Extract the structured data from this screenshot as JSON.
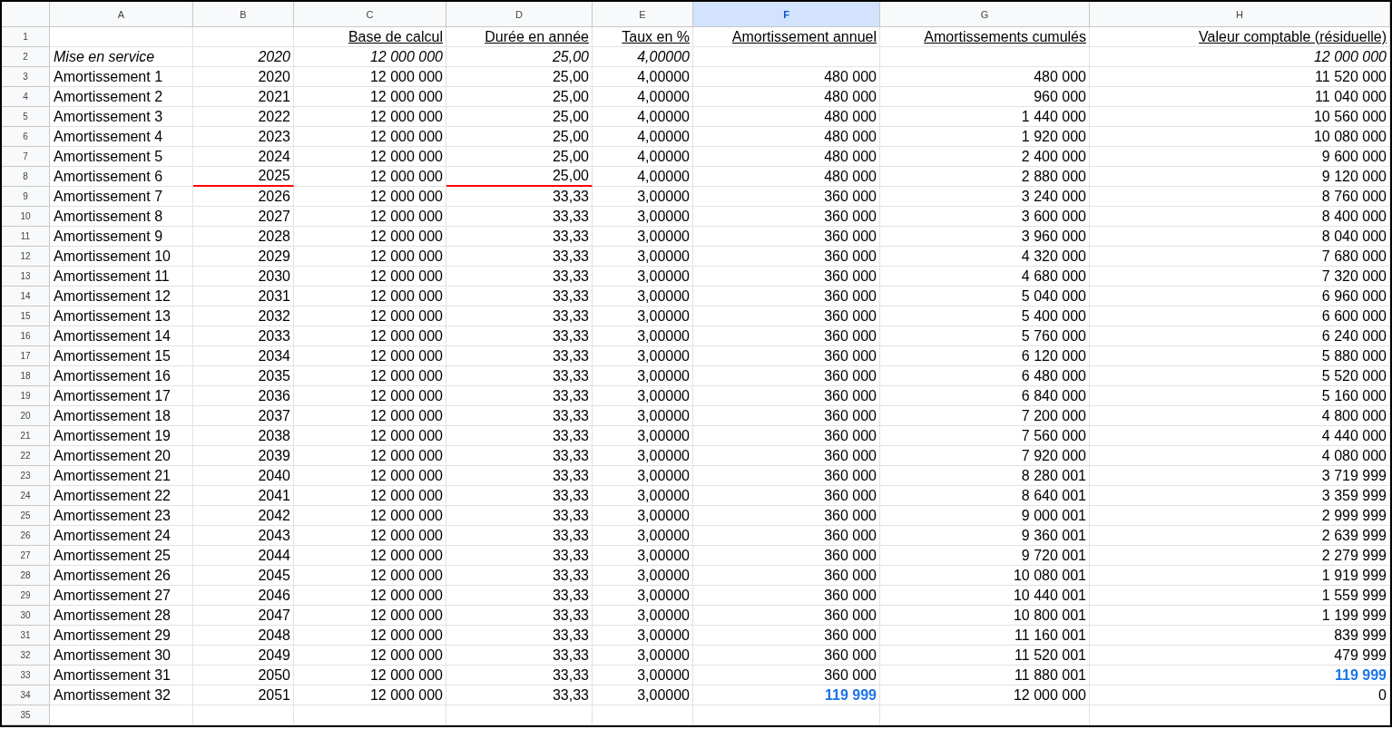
{
  "columns": [
    {
      "label": "A",
      "selected": false
    },
    {
      "label": "B",
      "selected": false
    },
    {
      "label": "C",
      "selected": false
    },
    {
      "label": "D",
      "selected": false
    },
    {
      "label": "E",
      "selected": false
    },
    {
      "label": "F",
      "selected": true
    },
    {
      "label": "G",
      "selected": false
    },
    {
      "label": "H",
      "selected": false
    }
  ],
  "rows": [
    {
      "number": "1",
      "kind": "header",
      "cells": [
        null,
        null,
        "Base de calcul",
        "Durée en année",
        "Taux en %",
        "Amortissement annuel",
        "Amortissements cumulés",
        "Valeur comptable (résiduelle)"
      ]
    },
    {
      "number": "2",
      "kind": "italic",
      "cells": [
        "Mise en service",
        "2020",
        "12 000 000",
        "25,00",
        "4,00000",
        null,
        null,
        "12 000 000"
      ]
    },
    {
      "number": "3",
      "kind": "data",
      "cells": [
        "Amortissement 1",
        "2020",
        "12 000 000",
        "25,00",
        "4,00000",
        "480 000",
        "480 000",
        "11 520 000"
      ]
    },
    {
      "number": "4",
      "kind": "data",
      "cells": [
        "Amortissement 2",
        "2021",
        "12 000 000",
        "25,00",
        "4,00000",
        "480 000",
        "960 000",
        "11 040 000"
      ]
    },
    {
      "number": "5",
      "kind": "data",
      "cells": [
        "Amortissement 3",
        "2022",
        "12 000 000",
        "25,00",
        "4,00000",
        "480 000",
        "1 440 000",
        "10 560 000"
      ]
    },
    {
      "number": "6",
      "kind": "data",
      "cells": [
        "Amortissement 4",
        "2023",
        "12 000 000",
        "25,00",
        "4,00000",
        "480 000",
        "1 920 000",
        "10 080 000"
      ]
    },
    {
      "number": "7",
      "kind": "data",
      "cells": [
        "Amortissement 5",
        "2024",
        "12 000 000",
        "25,00",
        "4,00000",
        "480 000",
        "2 400 000",
        "9 600 000"
      ]
    },
    {
      "number": "8",
      "kind": "data",
      "cells": [
        "Amortissement 6",
        {
          "text": "2025",
          "kind": "red-underline"
        },
        "12 000 000",
        {
          "text": "25,00",
          "kind": "red-underline"
        },
        "4,00000",
        "480 000",
        "2 880 000",
        "9 120 000"
      ]
    },
    {
      "number": "9",
      "kind": "data",
      "cells": [
        "Amortissement 7",
        "2026",
        "12 000 000",
        "33,33",
        "3,00000",
        "360 000",
        "3 240 000",
        "8 760 000"
      ]
    },
    {
      "number": "10",
      "kind": "data",
      "cells": [
        "Amortissement 8",
        "2027",
        "12 000 000",
        "33,33",
        "3,00000",
        "360 000",
        "3 600 000",
        "8 400 000"
      ]
    },
    {
      "number": "11",
      "kind": "data",
      "cells": [
        "Amortissement 9",
        "2028",
        "12 000 000",
        "33,33",
        "3,00000",
        "360 000",
        "3 960 000",
        "8 040 000"
      ]
    },
    {
      "number": "12",
      "kind": "data",
      "cells": [
        "Amortissement 10",
        "2029",
        "12 000 000",
        "33,33",
        "3,00000",
        "360 000",
        "4 320 000",
        "7 680 000"
      ]
    },
    {
      "number": "13",
      "kind": "data",
      "cells": [
        "Amortissement 11",
        "2030",
        "12 000 000",
        "33,33",
        "3,00000",
        "360 000",
        "4 680 000",
        "7 320 000"
      ]
    },
    {
      "number": "14",
      "kind": "data",
      "cells": [
        "Amortissement 12",
        "2031",
        "12 000 000",
        "33,33",
        "3,00000",
        "360 000",
        "5 040 000",
        "6 960 000"
      ]
    },
    {
      "number": "15",
      "kind": "data",
      "cells": [
        "Amortissement 13",
        "2032",
        "12 000 000",
        "33,33",
        "3,00000",
        "360 000",
        "5 400 000",
        "6 600 000"
      ]
    },
    {
      "number": "16",
      "kind": "data",
      "cells": [
        "Amortissement 14",
        "2033",
        "12 000 000",
        "33,33",
        "3,00000",
        "360 000",
        "5 760 000",
        "6 240 000"
      ]
    },
    {
      "number": "17",
      "kind": "data",
      "cells": [
        "Amortissement 15",
        "2034",
        "12 000 000",
        "33,33",
        "3,00000",
        "360 000",
        "6 120 000",
        "5 880 000"
      ]
    },
    {
      "number": "18",
      "kind": "data",
      "cells": [
        "Amortissement 16",
        "2035",
        "12 000 000",
        "33,33",
        "3,00000",
        "360 000",
        "6 480 000",
        "5 520 000"
      ]
    },
    {
      "number": "19",
      "kind": "data",
      "cells": [
        "Amortissement 17",
        "2036",
        "12 000 000",
        "33,33",
        "3,00000",
        "360 000",
        "6 840 000",
        "5 160 000"
      ]
    },
    {
      "number": "20",
      "kind": "data",
      "cells": [
        "Amortissement 18",
        "2037",
        "12 000 000",
        "33,33",
        "3,00000",
        "360 000",
        "7 200 000",
        "4 800 000"
      ]
    },
    {
      "number": "21",
      "kind": "data",
      "cells": [
        "Amortissement 19",
        "2038",
        "12 000 000",
        "33,33",
        "3,00000",
        "360 000",
        "7 560 000",
        "4 440 000"
      ]
    },
    {
      "number": "22",
      "kind": "data",
      "cells": [
        "Amortissement 20",
        "2039",
        "12 000 000",
        "33,33",
        "3,00000",
        "360 000",
        "7 920 000",
        "4 080 000"
      ]
    },
    {
      "number": "23",
      "kind": "data",
      "cells": [
        "Amortissement 21",
        "2040",
        "12 000 000",
        "33,33",
        "3,00000",
        "360 000",
        "8 280 001",
        "3 719 999"
      ]
    },
    {
      "number": "24",
      "kind": "data",
      "cells": [
        "Amortissement 22",
        "2041",
        "12 000 000",
        "33,33",
        "3,00000",
        "360 000",
        "8 640 001",
        "3 359 999"
      ]
    },
    {
      "number": "25",
      "kind": "data",
      "cells": [
        "Amortissement 23",
        "2042",
        "12 000 000",
        "33,33",
        "3,00000",
        "360 000",
        "9 000 001",
        "2 999 999"
      ]
    },
    {
      "number": "26",
      "kind": "data",
      "cells": [
        "Amortissement 24",
        "2043",
        "12 000 000",
        "33,33",
        "3,00000",
        "360 000",
        "9 360 001",
        "2 639 999"
      ]
    },
    {
      "number": "27",
      "kind": "data",
      "cells": [
        "Amortissement 25",
        "2044",
        "12 000 000",
        "33,33",
        "3,00000",
        "360 000",
        "9 720 001",
        "2 279 999"
      ]
    },
    {
      "number": "28",
      "kind": "data",
      "cells": [
        "Amortissement 26",
        "2045",
        "12 000 000",
        "33,33",
        "3,00000",
        "360 000",
        "10 080 001",
        "1 919 999"
      ]
    },
    {
      "number": "29",
      "kind": "data",
      "cells": [
        "Amortissement 27",
        "2046",
        "12 000 000",
        "33,33",
        "3,00000",
        "360 000",
        "10 440 001",
        "1 559 999"
      ]
    },
    {
      "number": "30",
      "kind": "data",
      "cells": [
        "Amortissement 28",
        "2047",
        "12 000 000",
        "33,33",
        "3,00000",
        "360 000",
        "10 800 001",
        "1 199 999"
      ]
    },
    {
      "number": "31",
      "kind": "data",
      "cells": [
        "Amortissement 29",
        "2048",
        "12 000 000",
        "33,33",
        "3,00000",
        "360 000",
        "11 160 001",
        "839 999"
      ]
    },
    {
      "number": "32",
      "kind": "data",
      "cells": [
        "Amortissement 30",
        "2049",
        "12 000 000",
        "33,33",
        "3,00000",
        "360 000",
        "11 520 001",
        "479 999"
      ]
    },
    {
      "number": "33",
      "kind": "data",
      "cells": [
        "Amortissement 31",
        "2050",
        "12 000 000",
        "33,33",
        "3,00000",
        "360 000",
        "11 880 001",
        {
          "text": "119 999",
          "kind": "blue-bold"
        }
      ]
    },
    {
      "number": "34",
      "kind": "data",
      "cells": [
        "Amortissement 32",
        "2051",
        "12 000 000",
        "33,33",
        "3,00000",
        {
          "text": "119 999",
          "kind": "blue-bold"
        },
        "12 000 000",
        "0"
      ]
    },
    {
      "number": "35"
    }
  ]
}
